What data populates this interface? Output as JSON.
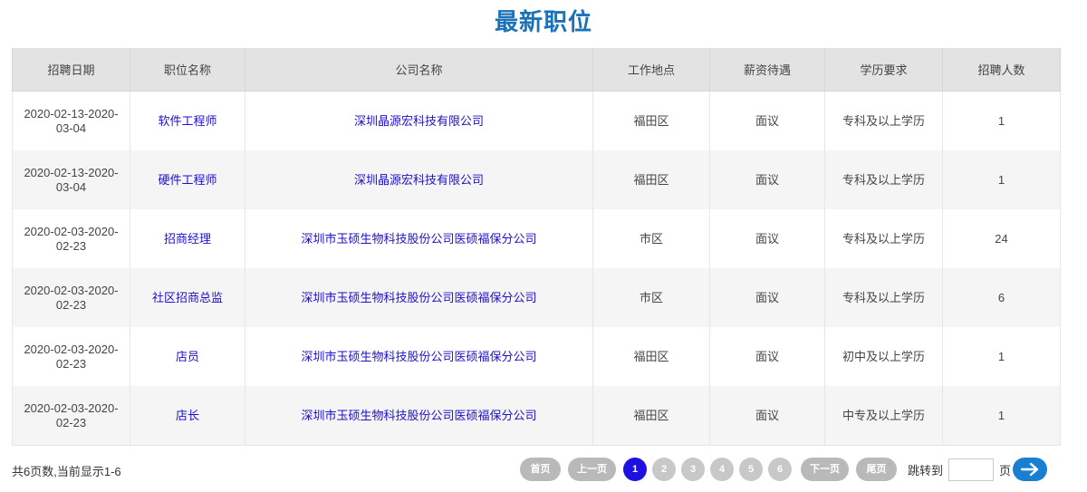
{
  "page_title": "最新职位",
  "table": {
    "headers": [
      "招聘日期",
      "职位名称",
      "公司名称",
      "工作地点",
      "薪资待遇",
      "学历要求",
      "招聘人数"
    ],
    "rows": [
      {
        "date": "2020-02-13-2020-03-04",
        "position": "软件工程师",
        "company": "深圳晶源宏科技有限公司",
        "location": "福田区",
        "salary": "面议",
        "education": "专科及以上学历",
        "count": "1"
      },
      {
        "date": "2020-02-13-2020-03-04",
        "position": "硬件工程师",
        "company": "深圳晶源宏科技有限公司",
        "location": "福田区",
        "salary": "面议",
        "education": "专科及以上学历",
        "count": "1"
      },
      {
        "date": "2020-02-03-2020-02-23",
        "position": "招商经理",
        "company": "深圳市玉硕生物科技股份公司医硕福保分公司",
        "location": "市区",
        "salary": "面议",
        "education": "专科及以上学历",
        "count": "24"
      },
      {
        "date": "2020-02-03-2020-02-23",
        "position": "社区招商总监",
        "company": "深圳市玉硕生物科技股份公司医硕福保分公司",
        "location": "市区",
        "salary": "面议",
        "education": "专科及以上学历",
        "count": "6"
      },
      {
        "date": "2020-02-03-2020-02-23",
        "position": "店员",
        "company": "深圳市玉硕生物科技股份公司医硕福保分公司",
        "location": "福田区",
        "salary": "面议",
        "education": "初中及以上学历",
        "count": "1"
      },
      {
        "date": "2020-02-03-2020-02-23",
        "position": "店长",
        "company": "深圳市玉硕生物科技股份公司医硕福保分公司",
        "location": "福田区",
        "salary": "面议",
        "education": "中专及以上学历",
        "count": "1"
      }
    ]
  },
  "footer": {
    "summary": "共6页数,当前显示1-6"
  },
  "pagination": {
    "first": "首页",
    "prev": "上一页",
    "pages": [
      "1",
      "2",
      "3",
      "4",
      "5",
      "6"
    ],
    "current": "1",
    "next": "下一页",
    "last": "尾页",
    "jump_label": "跳转到",
    "jump_value": "",
    "jump_unit": "页",
    "go_icon": "arrow-right-icon"
  },
  "colors": {
    "title": "#1a73b8",
    "link": "#1d10c9",
    "active_page": "#1d10e0",
    "go_button": "#1a7fd0"
  }
}
